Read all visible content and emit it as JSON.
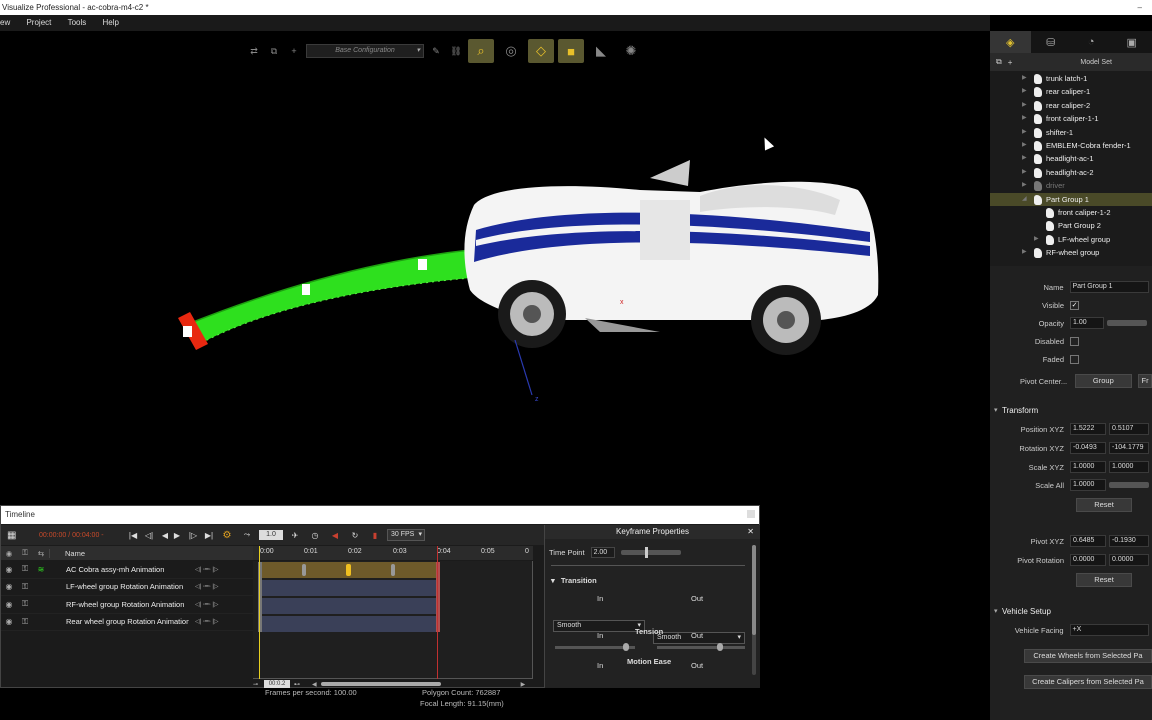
{
  "window": {
    "title": "Visualize Professional - ac-cobra-m4-c2 *"
  },
  "menu": {
    "items": [
      "ew",
      "Project",
      "Tools",
      "Help"
    ]
  },
  "toolbar": {
    "config_label": "Base Configuration"
  },
  "scene": {
    "axis_label": "z"
  },
  "right_panel": {
    "model_set_label": "Model Set",
    "tree": [
      {
        "label": "trunk latch-1",
        "indent": 0,
        "arrow": true,
        "selected": false,
        "dim": false
      },
      {
        "label": "rear caliper-1",
        "indent": 0,
        "arrow": true,
        "selected": false,
        "dim": false
      },
      {
        "label": "rear caliper-2",
        "indent": 0,
        "arrow": true,
        "selected": false,
        "dim": false
      },
      {
        "label": "front caliper-1-1",
        "indent": 0,
        "arrow": true,
        "selected": false,
        "dim": false
      },
      {
        "label": "shifter-1",
        "indent": 0,
        "arrow": true,
        "selected": false,
        "dim": false
      },
      {
        "label": "EMBLEM-Cobra fender-1",
        "indent": 0,
        "arrow": true,
        "selected": false,
        "dim": false
      },
      {
        "label": "headlight-ac-1",
        "indent": 0,
        "arrow": true,
        "selected": false,
        "dim": false
      },
      {
        "label": "headlight-ac-2",
        "indent": 0,
        "arrow": true,
        "selected": false,
        "dim": false
      },
      {
        "label": "driver",
        "indent": 0,
        "arrow": true,
        "selected": false,
        "dim": true
      },
      {
        "label": "Part Group 1",
        "indent": 0,
        "arrow": true,
        "selected": true,
        "dim": false
      },
      {
        "label": "front caliper-1-2",
        "indent": 1,
        "arrow": false,
        "selected": false,
        "dim": false
      },
      {
        "label": "Part Group 2",
        "indent": 1,
        "arrow": false,
        "selected": false,
        "dim": false
      },
      {
        "label": "LF-wheel group",
        "indent": 1,
        "arrow": true,
        "selected": false,
        "dim": false
      },
      {
        "label": "RF-wheel group",
        "indent": 0,
        "arrow": true,
        "selected": false,
        "dim": false
      }
    ],
    "props": {
      "name_label": "Name",
      "name_value": "Part Group 1",
      "visible_label": "Visible",
      "visible_check": "✓",
      "opacity_label": "Opacity",
      "opacity_value": "1.00",
      "disabled_label": "Disabled",
      "faded_label": "Faded",
      "pivot_center_label": "Pivot Center...",
      "pivot_btn": "Group",
      "pivot_btn2": "Fr"
    },
    "transform": {
      "header": "Transform",
      "position_label": "Position XYZ",
      "position": [
        "1.5222",
        "0.5107"
      ],
      "rotation_label": "Rotation XYZ",
      "rotation": [
        "-0.0493",
        "-104.1779"
      ],
      "scale_label": "Scale XYZ",
      "scale": [
        "1.0000",
        "1.0000"
      ],
      "scale_all_label": "Scale All",
      "scale_all": "1.0000",
      "reset": "Reset",
      "pivot_xyz_label": "Pivot XYZ",
      "pivot_xyz": [
        "0.6485",
        "-0.1930"
      ],
      "pivot_rot_label": "Pivot Rotation",
      "pivot_rot": [
        "0.0000",
        "0.0000"
      ],
      "reset2": "Reset"
    },
    "vehicle": {
      "header": "Vehicle Setup",
      "facing_label": "Vehicle Facing",
      "facing_value": "+X",
      "wheels_btn": "Create Wheels from Selected Pa",
      "calipers_btn": "Create Calipers from Selected Pa"
    }
  },
  "timeline": {
    "title": "Timeline",
    "time_display": "00:00:00 / 00:04:00 -",
    "speed": "1.0",
    "fps": "30 FPS",
    "name_header": "Name",
    "tracks": [
      "AC Cobra assy-mh Animation",
      "LF-wheel group Rotation Animation",
      "RF-wheel group Rotation Animation",
      "Rear wheel group Rotation Animation"
    ],
    "ruler": [
      "0:00",
      "0:01",
      "0:02",
      "0:03",
      "0:04",
      "0:05",
      "0"
    ],
    "zoom_value": "00:0.2"
  },
  "keyframe": {
    "title": "Keyframe Properties",
    "time_point_label": "Time Point",
    "time_point_value": "2.00",
    "transition_header": "Transition",
    "in_label": "In",
    "out_label": "Out",
    "in_value": "Smooth",
    "out_value": "Smooth",
    "tension_label": "Tension",
    "motion_ease_label": "Motion Ease"
  },
  "status": {
    "fps": "Frames per second: 100.00",
    "polygons": "Polygon Count: 762887",
    "focal": "Focal Length: 91.15(mm)"
  }
}
